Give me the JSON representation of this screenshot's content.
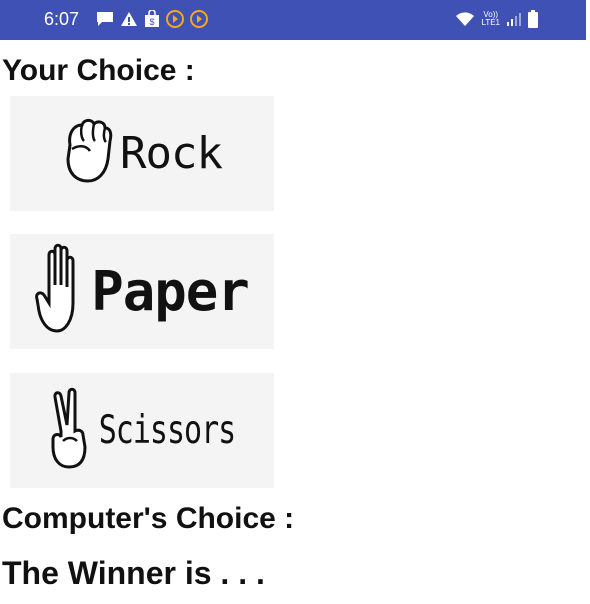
{
  "status_bar": {
    "time": "6:07",
    "color": "#3f51b5",
    "left_icons": [
      "chat-icon",
      "warning-icon",
      "shopping-bag-icon",
      "play-circle-icon",
      "play-circle-icon"
    ],
    "right_icons": [
      "wifi-icon",
      "volte-icon",
      "signal-icon",
      "battery-icon"
    ],
    "network_label_top": "Vo))",
    "network_label_bottom": "LTE1"
  },
  "your_choice_label": "Your Choice :",
  "choices": [
    {
      "label": "Rock",
      "icon": "fist-icon"
    },
    {
      "label": "Paper",
      "icon": "open-hand-icon"
    },
    {
      "label": "Scissors",
      "icon": "victory-hand-icon"
    }
  ],
  "computer_choice_label": "Computer's Choice :",
  "winner_label": "The Winner is . . ."
}
